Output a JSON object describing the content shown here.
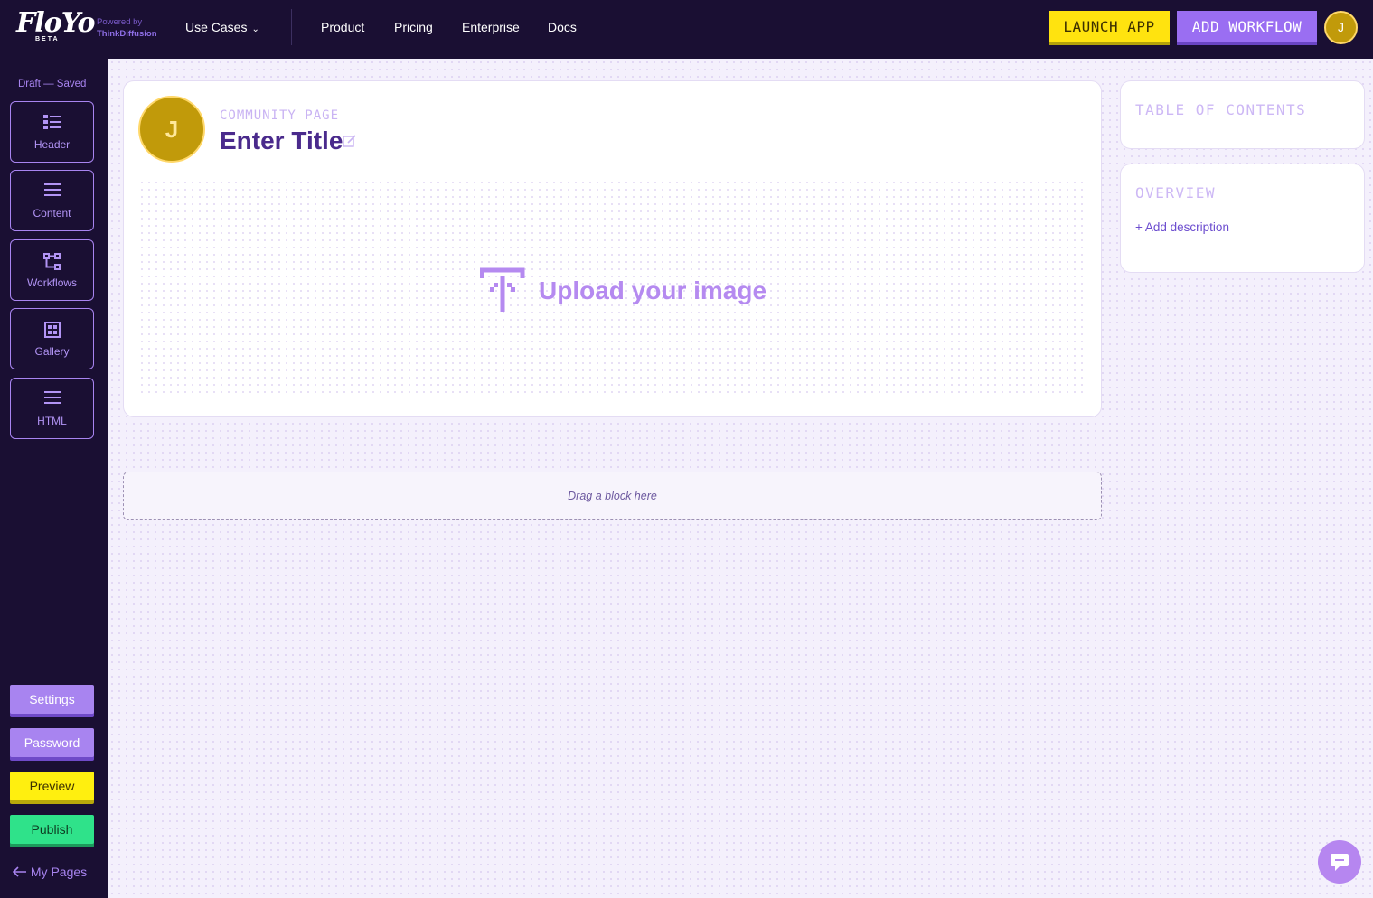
{
  "brand": {
    "logo_text": "FloYo",
    "beta": "BETA",
    "powered_by": "Powered by",
    "partner": "ThinkDiffusion"
  },
  "nav": {
    "use_cases": "Use Cases",
    "links": [
      "Product",
      "Pricing",
      "Enterprise",
      "Docs"
    ],
    "launch_app": "LAUNCH APP",
    "add_workflow": "ADD WORKFLOW",
    "user_initial": "J"
  },
  "sidebar": {
    "status": "Draft — Saved",
    "tools": [
      {
        "label": "Header",
        "icon": "header-icon"
      },
      {
        "label": "Content",
        "icon": "content-icon"
      },
      {
        "label": "Workflows",
        "icon": "workflows-icon"
      },
      {
        "label": "Gallery",
        "icon": "gallery-icon"
      },
      {
        "label": "HTML",
        "icon": "html-icon"
      }
    ],
    "actions": {
      "settings": "Settings",
      "password": "Password",
      "preview": "Preview",
      "publish": "Publish"
    },
    "my_pages": "My Pages"
  },
  "header_card": {
    "avatar_initial": "J",
    "label": "COMMUNITY PAGE",
    "title": "Enter Title",
    "upload_text": "Upload your image"
  },
  "drop_zone": {
    "text": "Drag a block here"
  },
  "right_panel": {
    "toc_heading": "TABLE OF CONTENTS",
    "overview_heading": "OVERVIEW",
    "add_description": "+ Add description"
  },
  "colors": {
    "nav_bg": "#1a0f33",
    "accent_purple": "#a884f0",
    "launch_yellow": "#ffe30f",
    "publish_green": "#2fe28a"
  }
}
